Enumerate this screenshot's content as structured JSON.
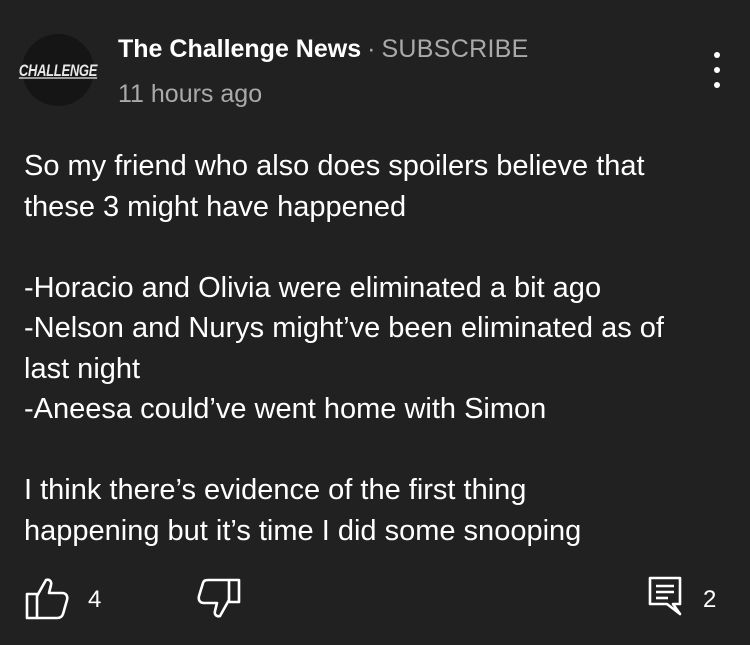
{
  "comment": {
    "avatar_text": "CHALLENGE",
    "channel_name": "The Challenge News",
    "separator": "·",
    "subscribe_label": "SUBSCRIBE",
    "timestamp": "11 hours ago",
    "body_lines": [
      "So my friend who also does spoilers believe that",
      "these 3 might have happened",
      "",
      "-Horacio and Olivia were eliminated a bit ago",
      "-Nelson and Nurys might’ve been eliminated as of",
      "last night",
      "-Aneesa could’ve went home with Simon",
      "",
      "I think there’s evidence of the first thing",
      "happening but it’s time I did some snooping"
    ]
  },
  "actions": {
    "like_icon": "thumbs-up-icon",
    "like_count": "4",
    "dislike_icon": "thumbs-down-icon",
    "reply_icon": "comment-icon",
    "reply_count": "2",
    "menu_icon": "more-vertical-icon"
  },
  "colors": {
    "background": "#212121",
    "primary_text": "#ffffff",
    "secondary_text": "#aaaaaa",
    "avatar_bg": "#151515"
  }
}
